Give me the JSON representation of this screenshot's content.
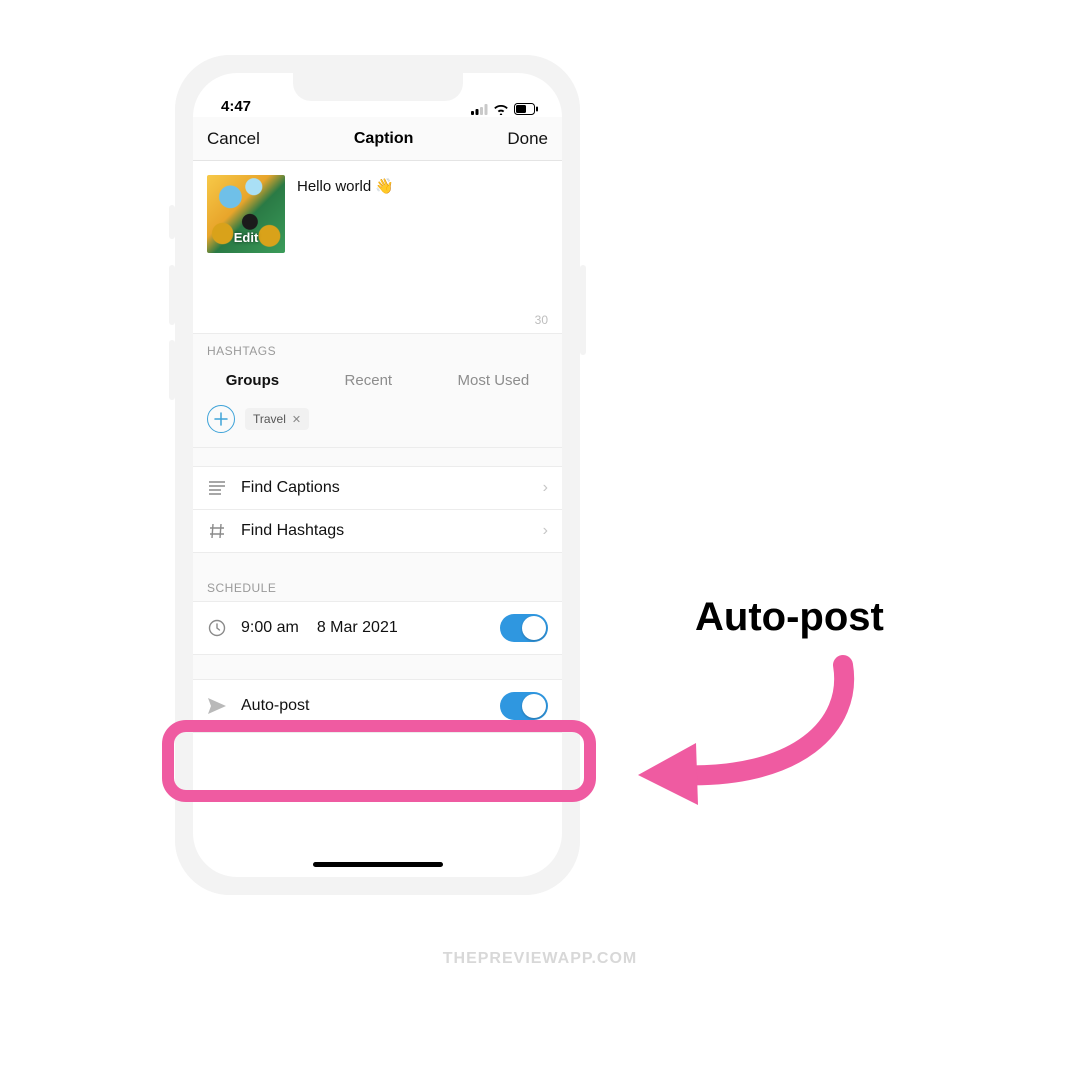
{
  "statusbar": {
    "time": "4:47"
  },
  "navbar": {
    "cancel": "Cancel",
    "title": "Caption",
    "done": "Done"
  },
  "caption": {
    "text": "Hello world 👋",
    "thumb_label": "Edit",
    "char_count": "30"
  },
  "hashtags": {
    "section_label": "HASHTAGS",
    "tabs": {
      "groups": "Groups",
      "recent": "Recent",
      "most_used": "Most Used"
    },
    "tag": "Travel"
  },
  "rows": {
    "find_captions": "Find Captions",
    "find_hashtags": "Find Hashtags"
  },
  "schedule": {
    "section_label": "SCHEDULE",
    "time": "9:00 am",
    "date": "8 Mar 2021",
    "autopost_label": "Auto-post"
  },
  "callout": {
    "label": "Auto-post"
  },
  "watermark": "THEPREVIEWAPP.COM"
}
